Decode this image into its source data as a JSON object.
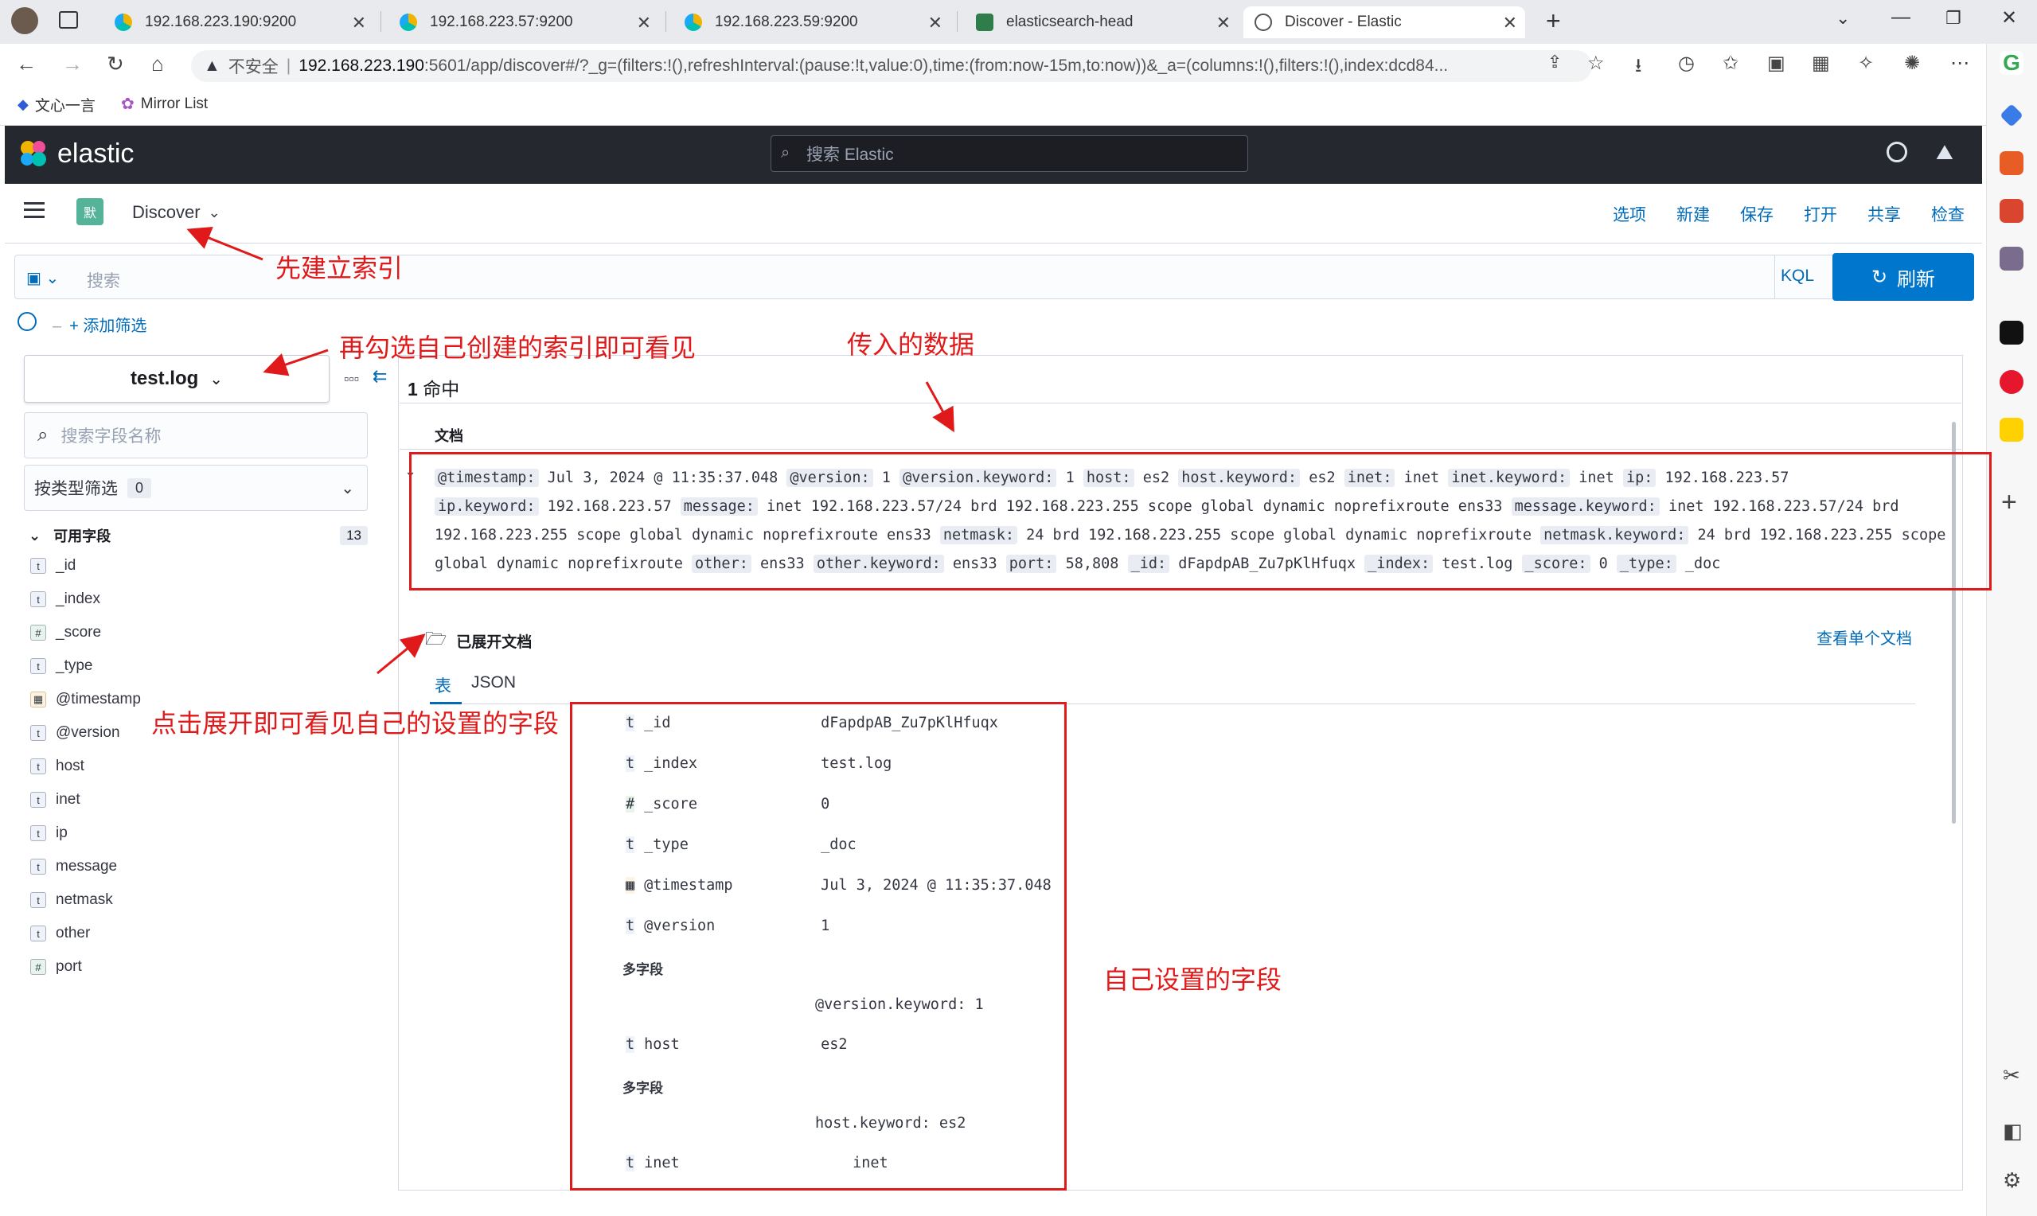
{
  "browser": {
    "tabs": [
      {
        "title": "192.168.223.190:9200"
      },
      {
        "title": "192.168.223.57:9200"
      },
      {
        "title": "192.168.223.59:9200"
      },
      {
        "title": "elasticsearch-head"
      },
      {
        "title": "Discover - Elastic"
      }
    ],
    "security": "不安全",
    "url_host": "192.168.223.190",
    "url_rest": ":5601/app/discover#/?_g=(filters:!(),refreshInterval:(pause:!t,value:0),time:(from:now-15m,to:now))&_a=(columns:!(),filters:!(),index:dcd84...",
    "bookmarks": [
      {
        "label": "文心一言"
      },
      {
        "label": "Mirror List"
      }
    ]
  },
  "kibana": {
    "logo": "elastic",
    "search_placeholder": "搜索 Elastic",
    "space_badge": "默",
    "app": "Discover",
    "top_links": [
      "选项",
      "新建",
      "保存",
      "打开",
      "共享",
      "检查"
    ],
    "query_placeholder": "搜索",
    "kql": "KQL",
    "refresh": "刷新",
    "add_filter": "+ 添加筛选"
  },
  "sidebar": {
    "index": "test.log",
    "field_search_placeholder": "搜索字段名称",
    "type_filter": "按类型筛选",
    "type_filter_count": "0",
    "available_fields_label": "可用字段",
    "available_fields_count": "13",
    "fields": [
      {
        "type": "t",
        "name": "_id"
      },
      {
        "type": "t",
        "name": "_index"
      },
      {
        "type": "#",
        "name": "_score"
      },
      {
        "type": "t",
        "name": "_type"
      },
      {
        "type": "date",
        "name": "@timestamp"
      },
      {
        "type": "t",
        "name": "@version"
      },
      {
        "type": "t",
        "name": "host"
      },
      {
        "type": "t",
        "name": "inet"
      },
      {
        "type": "t",
        "name": "ip"
      },
      {
        "type": "t",
        "name": "message"
      },
      {
        "type": "t",
        "name": "netmask"
      },
      {
        "type": "t",
        "name": "other"
      },
      {
        "type": "#",
        "name": "port"
      }
    ]
  },
  "results": {
    "hits": "1",
    "hits_label": "命中",
    "doc_header": "文档",
    "doc_line1": [
      [
        "@timestamp:",
        "Jul 3, 2024 @ 11:35:37.048"
      ],
      [
        "@version:",
        "1"
      ],
      [
        "@version.keyword:",
        "1"
      ],
      [
        "host:",
        "es2"
      ],
      [
        "host.keyword:",
        "es2"
      ],
      [
        "inet:",
        "inet"
      ],
      [
        "inet.keyword:",
        "inet"
      ],
      [
        "ip:",
        "192.168.223.57"
      ]
    ],
    "doc_line2": [
      [
        "ip.keyword:",
        "192.168.223.57"
      ],
      [
        "message:",
        "inet 192.168.223.57/24 brd 192.168.223.255 scope global dynamic noprefixroute ens33"
      ],
      [
        "message.keyword:",
        "inet 192.168.223.57/24 brd"
      ]
    ],
    "doc_line3": [
      [
        "",
        "192.168.223.255 scope global dynamic noprefixroute ens33"
      ],
      [
        "netmask:",
        "24 brd 192.168.223.255 scope global dynamic noprefixroute"
      ],
      [
        "netmask.keyword:",
        "24 brd 192.168.223.255 scope"
      ]
    ],
    "doc_line4": [
      [
        "",
        "global dynamic noprefixroute"
      ],
      [
        "other:",
        "ens33"
      ],
      [
        "other.keyword:",
        "ens33"
      ],
      [
        "port:",
        "58,808"
      ],
      [
        "_id:",
        "dFapdpAB_Zu7pKlHfuqx"
      ],
      [
        "_index:",
        "test.log"
      ],
      [
        "_score:",
        "0"
      ],
      [
        "_type:",
        "_doc"
      ]
    ],
    "expanded_label": "已展开文档",
    "view_single": "查看单个文档",
    "tab_table": "表",
    "tab_json": "JSON",
    "multi_field": "多字段",
    "rows": [
      {
        "type": "t",
        "name": "_id",
        "value": "dFapdpAB_Zu7pKlHfuqx"
      },
      {
        "type": "t",
        "name": "_index",
        "value": "test.log"
      },
      {
        "type": "#",
        "name": "_score",
        "value": "0"
      },
      {
        "type": "t",
        "name": "_type",
        "value": "_doc"
      },
      {
        "type": "date",
        "name": "@timestamp",
        "value": "Jul 3, 2024 @ 11:35:37.048"
      },
      {
        "type": "t",
        "name": "@version",
        "value": "1"
      },
      {
        "type": "sub",
        "name": "",
        "value": "@version.keyword: 1"
      },
      {
        "type": "t",
        "name": "host",
        "value": "es2"
      },
      {
        "type": "sub",
        "name": "",
        "value": "host.keyword: es2"
      },
      {
        "type": "t",
        "name": "inet",
        "value": "inet"
      }
    ]
  },
  "annotations": {
    "a1": "先建立索引",
    "a2": "再勾选自己创建的索引即可看见",
    "a3": "传入的数据",
    "a4": "点击展开即可看见自己的设置的字段",
    "a5": "自己设置的字段"
  }
}
